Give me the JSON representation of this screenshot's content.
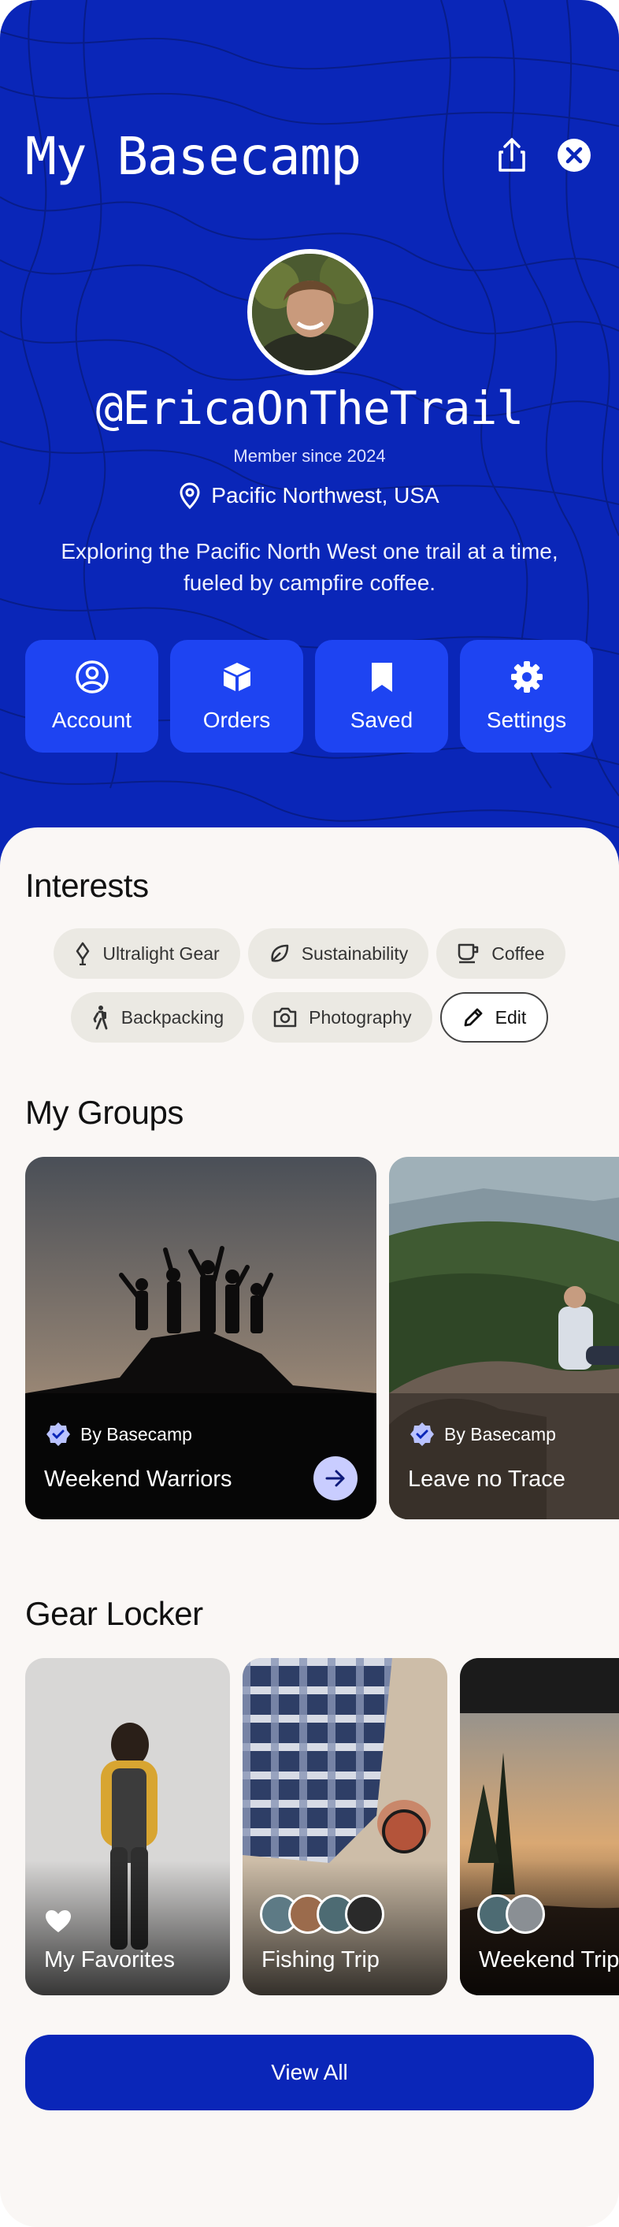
{
  "header": {
    "title": "My Basecamp",
    "share_icon": "share-icon",
    "close_icon": "close-icon"
  },
  "profile": {
    "handle": "@EricaOnTheTrail",
    "member_since": "Member since 2024",
    "location": "Pacific Northwest, USA",
    "bio": "Exploring the Pacific North West one trail at a time, fueled by campfire coffee."
  },
  "tiles": [
    {
      "label": "Account",
      "icon": "account-circle-icon"
    },
    {
      "label": "Orders",
      "icon": "package-icon"
    },
    {
      "label": "Saved",
      "icon": "bookmark-icon"
    },
    {
      "label": "Settings",
      "icon": "gear-icon"
    }
  ],
  "interests": {
    "title": "Interests",
    "chips": [
      {
        "label": "Ultralight Gear",
        "icon": "feather-icon"
      },
      {
        "label": "Sustainability",
        "icon": "leaf-icon"
      },
      {
        "label": "Coffee",
        "icon": "coffee-cup-icon"
      },
      {
        "label": "Backpacking",
        "icon": "hiker-icon"
      },
      {
        "label": "Photography",
        "icon": "camera-icon"
      }
    ],
    "edit_label": "Edit"
  },
  "groups": {
    "title": "My Groups",
    "items": [
      {
        "by": "By Basecamp",
        "name": "Weekend Warriors"
      },
      {
        "by": "By Basecamp",
        "name": "Leave no Trace"
      }
    ]
  },
  "gear_locker": {
    "title": "Gear Locker",
    "items": [
      {
        "label": "My Favorites"
      },
      {
        "label": "Fishing Trip"
      },
      {
        "label": "Weekend Trip"
      }
    ],
    "view_all": "View All"
  },
  "colors": {
    "brand_blue": "#0a26b8",
    "tile_blue": "#1e44f2",
    "sheet_bg": "#faf7f5",
    "chip_bg": "#ebe9e3"
  }
}
